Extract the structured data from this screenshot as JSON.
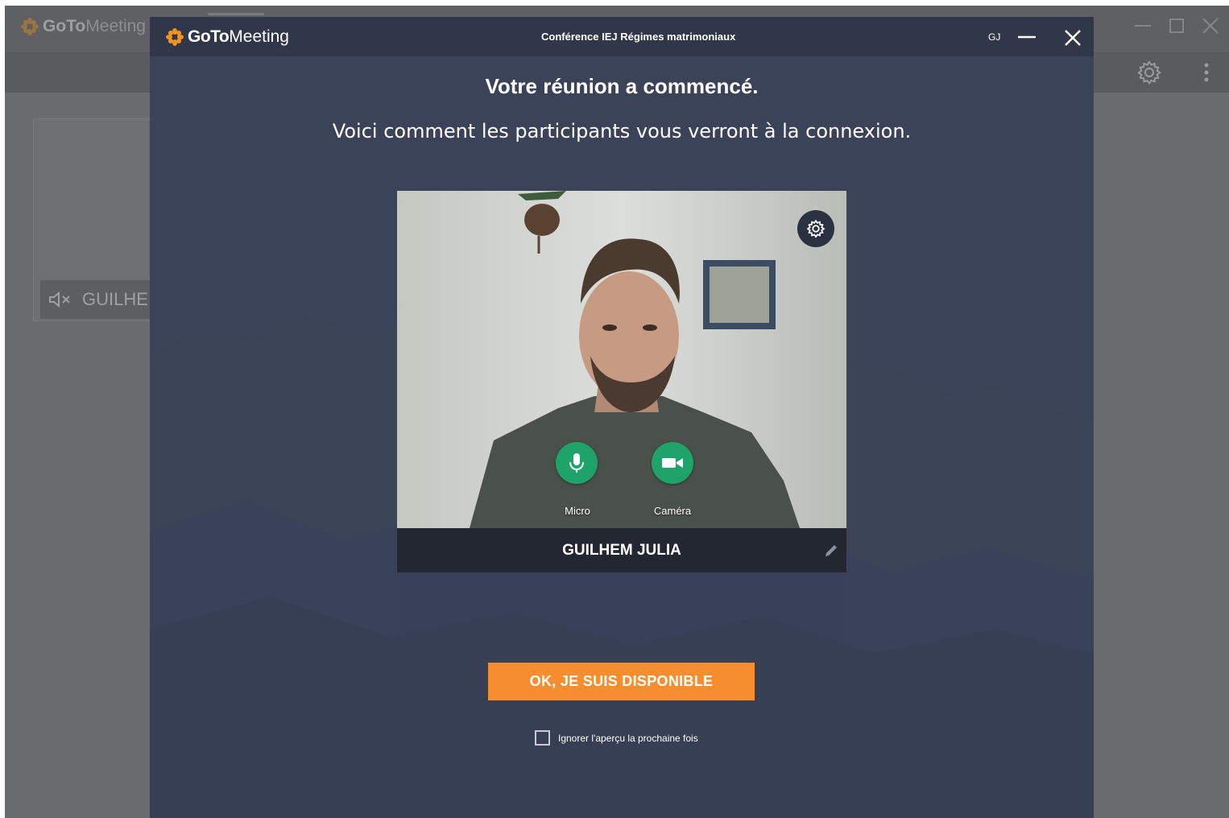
{
  "background_app": {
    "logo_goto": "GoTo",
    "logo_meeting": "Meeting",
    "tile_label": "GUILHE",
    "icons": [
      "minimize-icon",
      "maximize-icon",
      "close-icon",
      "gear-icon",
      "kebab-menu-icon",
      "speaker-muted-icon"
    ]
  },
  "modal": {
    "logo_goto": "GoTo",
    "logo_meeting": "Meeting",
    "conference_title": "Conférence IEJ Régimes matrimoniaux",
    "user_initials": "GJ",
    "heading": "Votre réunion a commencé.",
    "subheading": "Voici comment les participants vous verront à la connexion.",
    "preview": {
      "mic_label": "Micro",
      "camera_label": "Caméra",
      "participant_name": "GUILHEM JULIA"
    },
    "ok_button": "OK, JE SUIS DISPONIBLE",
    "skip_checkbox_label": "Ignorer l'aperçu la prochaine fois",
    "skip_checked": false
  },
  "colors": {
    "brand_orange": "#f68d2e",
    "logo_star": "#f7941e",
    "control_green": "#1ea36a",
    "modal_bg": "#3a4357",
    "titlebar_bg": "#2f3749"
  }
}
